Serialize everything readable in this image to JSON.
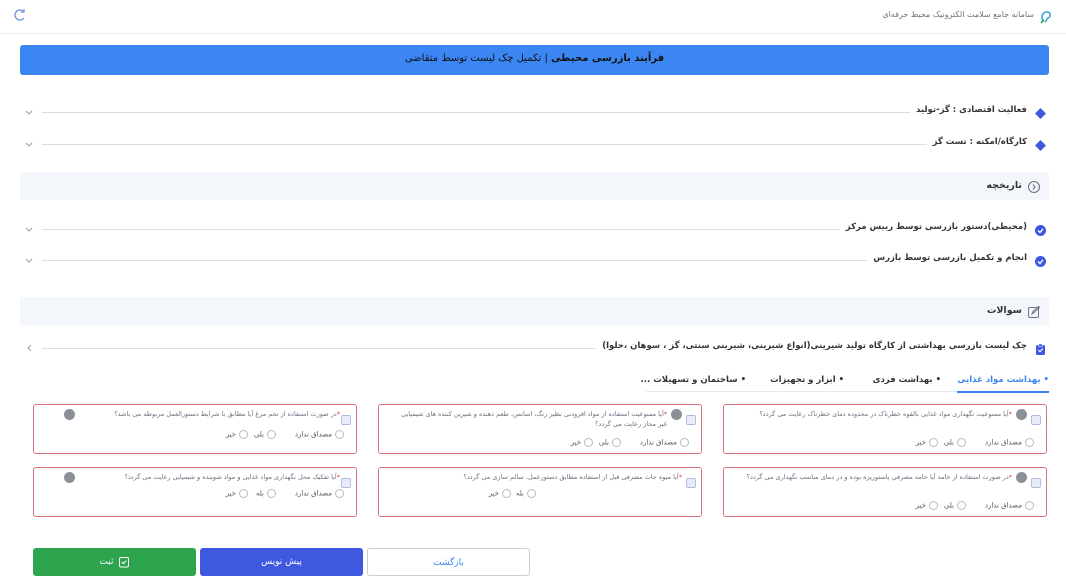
{
  "header": {
    "app_title": "سامانه جامع سلامت الکترونیک محیط حرفه‌ای",
    "logo_icon": "ear-logo-icon",
    "refresh_icon": "refresh-icon"
  },
  "banner": {
    "process_label": "فرآیند بازرسی محیطی",
    "separator": " | ",
    "step_label": "تکمیل چک لیست توسط متقاضی",
    "color": "#3b86f2"
  },
  "info_rows": [
    {
      "label": "فعالیت اقتصادی : گز-تولید"
    },
    {
      "label": "کارگاه/امکنه : تست گز"
    }
  ],
  "history": {
    "title": "تاریخچه",
    "items": [
      {
        "label": "(محیطی)دستور بازرسی توسط رییس مرکز"
      },
      {
        "label": "انجام و تکمیل بازرسی توسط بازرس"
      }
    ]
  },
  "questions": {
    "title": "سوالات",
    "checklist_title": "چک لیست بازرسی بهداشتی از کارگاه تولید شیرینی(انواع شیرینی، شیرینی سنتی، گز ، سوهان ،حلوا)",
    "tabs": [
      {
        "label": "• بهداشت مواد غذایی",
        "active": true
      },
      {
        "label": "• بهداشت فردی",
        "active": false
      },
      {
        "label": "• ابزار و تجهیزات",
        "active": false
      },
      {
        "label": "• ساختمان و تسهیلات ...",
        "active": false
      }
    ],
    "cards": [
      {
        "text": "آیا ممنوعیت نگهداری مواد غذایی بالقوه خطرناک در محدوده دمای خطرناک رعایت می گردد؟",
        "options": [
          "مصداق ندارد",
          "بلی",
          "خیر"
        ]
      },
      {
        "text": "آیا ممنوعیت استفاده از مواد افزودنی نظیر رنگ، اسانس، طعم دهنده و شیرین کننده های شیمیایی غیر مجاز رعایت می گردد؟",
        "options": [
          "مصداق ندارد",
          "بلی",
          "خیر"
        ]
      },
      {
        "text": "در صورت استفاده از تخم مرغ آیا مطابق با شرایط دستورالعمل مربوطه می باشد؟",
        "options": [
          "مصداق ندارد",
          "بلی",
          "خیر"
        ]
      },
      {
        "text": "در صورت استفاده از خامه آیا خامه مصرفی پاستوریزه بوده و در دمای مناسب نگهداری می گردد؟",
        "options": [
          "مصداق ندارد",
          "بلی",
          "خیر"
        ]
      },
      {
        "text": "آیا میوه جات مصرفی قبل از استفاده مطابق دستورعمل، سالم سازی می گردد؟",
        "options": [
          "بله",
          "خیر"
        ]
      },
      {
        "text": "آیا تفکیک محل نگهداری مواد غذایی و مواد شوینده و شیمیایی رعایت می گردد؟",
        "options": [
          "مصداق ندارد",
          "بله",
          "خیر"
        ]
      }
    ]
  },
  "actions": {
    "submit": "ثبت",
    "draft": "پیش نویس",
    "back": "بازگشت"
  }
}
